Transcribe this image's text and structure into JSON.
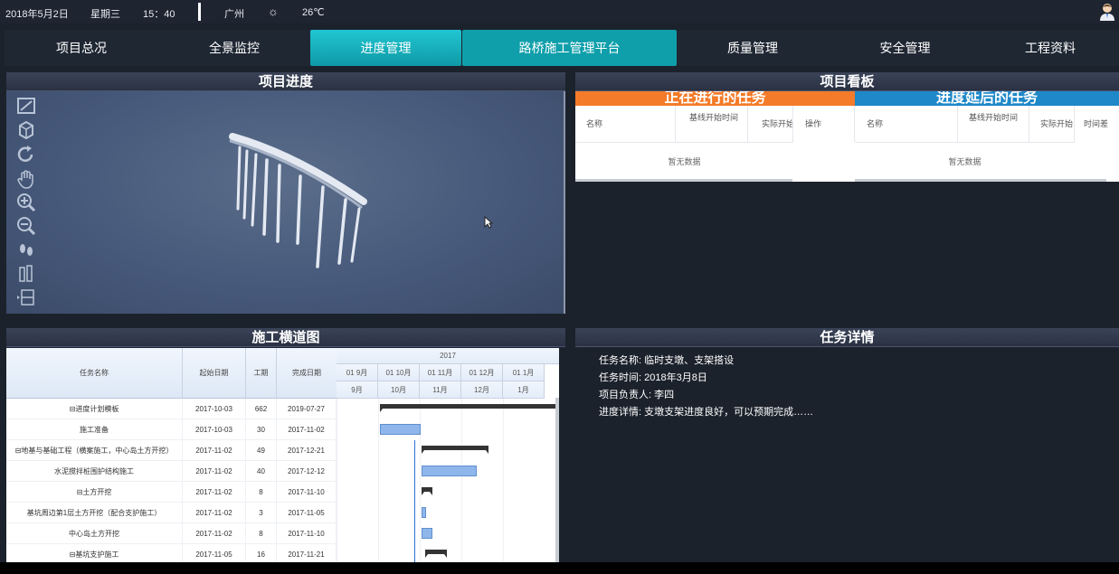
{
  "status": {
    "date": "2018年5月2日",
    "weekday": "星期三",
    "time": "15：40",
    "city": "广州",
    "weather_icon": "sun-icon",
    "temperature": "26℃"
  },
  "nav": {
    "items": [
      {
        "label": "项目总况"
      },
      {
        "label": "全景监控"
      },
      {
        "label": "进度管理"
      },
      {
        "label": "路桥施工管理平台"
      },
      {
        "label": "质量管理"
      },
      {
        "label": "安全管理"
      },
      {
        "label": "工程资料"
      }
    ],
    "active_index": 2,
    "accent": "#14b4c0"
  },
  "progress_panel": {
    "title": "项目进度",
    "tools": [
      "fit-view-icon",
      "cube-view-icon",
      "rotate-icon",
      "pan-hand-icon",
      "zoom-in-icon",
      "zoom-out-icon",
      "walk-icon",
      "section-icon",
      "layer-icon"
    ]
  },
  "kanban": {
    "title": "项目看板",
    "ongoing": {
      "title": "正在进行的任务",
      "color": "#f47b29",
      "columns": [
        "名称",
        "基线开始时间",
        "实际开始",
        "操作"
      ],
      "empty_text": "暂无数据"
    },
    "delayed": {
      "title": "进度延后的任务",
      "color": "#1e88c8",
      "columns": [
        "名称",
        "基线开始时间",
        "实际开始",
        "时间差"
      ],
      "empty_text": "暂无数据"
    }
  },
  "gantt": {
    "title": "施工横道图",
    "columns": [
      "任务名称",
      "起始日期",
      "工期",
      "完成日期"
    ],
    "year": "2017",
    "months_top": [
      "01 9月",
      "01 10月",
      "01 11月",
      "01 12月",
      "01 1月"
    ],
    "months_bottom": [
      "9月",
      "10月",
      "11月",
      "12月",
      "1月"
    ],
    "rows": [
      {
        "name": "⊟进度计划模板",
        "start": "2017-10-03",
        "duration": "662",
        "end": "2019-07-27"
      },
      {
        "name": "施工准备",
        "start": "2017-10-03",
        "duration": "30",
        "end": "2017-11-02"
      },
      {
        "name": "⊟地基与基础工程（横案施工，中心岛土方开挖）",
        "start": "2017-11-02",
        "duration": "49",
        "end": "2017-12-21"
      },
      {
        "name": "水泥搅拌桩围护结构施工",
        "start": "2017-11-02",
        "duration": "40",
        "end": "2017-12-12"
      },
      {
        "name": "⊟土方开挖",
        "start": "2017-11-02",
        "duration": "8",
        "end": "2017-11-10"
      },
      {
        "name": "基坑周边第1层土方开挖（配合支护施工）",
        "start": "2017-11-02",
        "duration": "3",
        "end": "2017-11-05"
      },
      {
        "name": "中心岛土方开挖",
        "start": "2017-11-02",
        "duration": "8",
        "end": "2017-11-10"
      },
      {
        "name": "⊟基坑支护施工",
        "start": "2017-11-05",
        "duration": "16",
        "end": "2017-11-21"
      }
    ]
  },
  "details": {
    "title": "任务详情",
    "lines": [
      "任务名称: 临时支墩、支架搭设",
      "任务时间: 2018年3月8日",
      "项目负责人: 李四",
      "进度详情: 支墩支架进度良好，可以预期完成……"
    ]
  }
}
